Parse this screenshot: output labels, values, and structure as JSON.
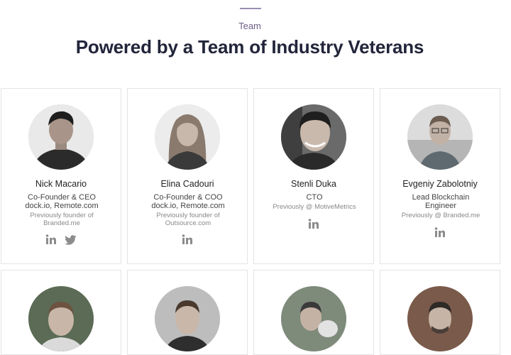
{
  "section": {
    "eyebrow": "Team",
    "heading": "Powered by a Team of Industry Veterans"
  },
  "members": [
    {
      "name": "Nick Macario",
      "role_line1": "Co-Founder & CEO",
      "role_line2": "dock.io, Remote.com",
      "previous_line1": "Previously founder of",
      "previous_line2": "Branded.me",
      "socials": [
        "linkedin-icon",
        "twitter-icon"
      ]
    },
    {
      "name": "Elina Cadouri",
      "role_line1": "Co-Founder & COO",
      "role_line2": "dock.io, Remote.com",
      "previous_line1": "Previously founder of",
      "previous_line2": "Outsource.com",
      "socials": [
        "linkedin-icon"
      ]
    },
    {
      "name": "Stenli Duka",
      "role_line1": "CTO",
      "role_line2": "",
      "previous_line1": "Previously @ MotiveMetrics",
      "previous_line2": "",
      "socials": [
        "linkedin-icon"
      ]
    },
    {
      "name": "Evgeniy Zabolotniy",
      "role_line1": "Lead Blockchain",
      "role_line2": "Engineer",
      "previous_line1": "Previously @ Branded.me",
      "previous_line2": "",
      "socials": [
        "linkedin-icon"
      ]
    }
  ],
  "colors": {
    "icon": "#8c8c8c",
    "heading": "#22253a",
    "eyebrow": "#6b5e86"
  }
}
